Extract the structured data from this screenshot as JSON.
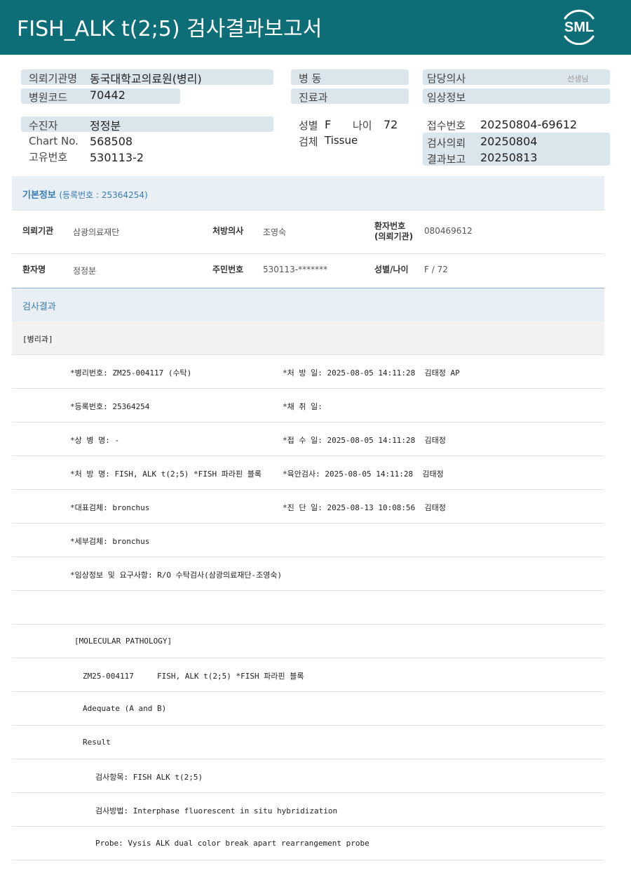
{
  "header": {
    "title": "FISH_ALK  t(2;5) 검사결과보고서",
    "logo_text": "SML"
  },
  "top": {
    "institution_label": "의뢰기관명",
    "institution_value": "동국대학교의료원(병리)",
    "hospital_code_label": "병원코드",
    "hospital_code_value": "70442",
    "ward_label": "병  동",
    "dept_label": "진료과",
    "doctor_label": "담당의사",
    "doctor_suffix": "선생님",
    "clinical_label": "임상정보",
    "patient_label": "수진자",
    "patient_value": "정정분",
    "chart_label": "Chart No.",
    "chart_value": "568508",
    "unique_label": "고유번호",
    "unique_value": "530113-2",
    "sex_label": "성별",
    "sex_value": "F",
    "age_label": "나이",
    "age_value": "72",
    "specimen_label": "검체",
    "specimen_value": "Tissue",
    "receipt_label": "접수번호",
    "receipt_value": "20250804-69612",
    "request_label": "검사의뢰",
    "request_value": "20250804",
    "report_label": "결과보고",
    "report_value": "20250813"
  },
  "basic": {
    "section_title": "기본정보",
    "reg_number_text": "(등록번호 : 25364254)",
    "inst_label": "의뢰기관",
    "inst_value": "삼광의료재단",
    "presc_label": "처방의사",
    "presc_value": "조영숙",
    "pno_label_1": "환자번호",
    "pno_label_2": "(의뢰기관)",
    "pno_value": "080469612",
    "name_label": "환자명",
    "name_value": "정정분",
    "rrn_label": "주민번호",
    "rrn_value": "530113-*******",
    "sexage_label": "성별/나이",
    "sexage_value": "F / 72"
  },
  "results": {
    "section_title": "검사결과",
    "dept_row": "[병리과]",
    "rows": [
      {
        "left": "*병리번호: ZM25-004117 (수탁)",
        "right": "*처 방 일: 2025-08-05 14:11:28  김태정 AP"
      },
      {
        "left": "*등록번호: 25364254",
        "right": "*채 취 일:"
      },
      {
        "left": "*상 병 명: -",
        "right": "*접 수 일: 2025-08-05 14:11:28  김태정"
      },
      {
        "left": "*처 방 명: FISH, ALK t(2;5) *FISH 파라핀 블록",
        "right": "*육안검사: 2025-08-05 14:11:28  김태정"
      },
      {
        "left": "*대표검체: bronchus",
        "right": "*진 단 일: 2025-08-13 10:08:56  김태정"
      },
      {
        "left": "*세부검체: bronchus",
        "right": ""
      },
      {
        "left": "*임상정보 및 요구사항: R/O 수탁검사(삼광의료재단-조영숙)",
        "right": ""
      },
      {
        "left": "",
        "right": ""
      }
    ],
    "report_lines": [
      {
        "text": "[MOLECULAR PATHOLOGY]",
        "indent": 1
      },
      {
        "text": "ZM25-004117     FISH, ALK t(2;5) *FISH 파라핀 블록",
        "indent": 2
      },
      {
        "text": "Adequate (A and B)",
        "indent": 2
      },
      {
        "text": "Result",
        "indent": 2
      },
      {
        "text": "검사항목: FISH ALK t(2;5)",
        "indent": 3
      },
      {
        "text": "검사방법: Interphase fluorescent in situ hybridization",
        "indent": 3
      },
      {
        "text": "Probe: Vysis ALK dual color break apart rearrangement probe",
        "indent": 3
      }
    ]
  },
  "colors": {
    "header_bg": "#0e6e78",
    "pill_bg": "#dbe6ec",
    "section_blue": "#3a7ab3"
  }
}
